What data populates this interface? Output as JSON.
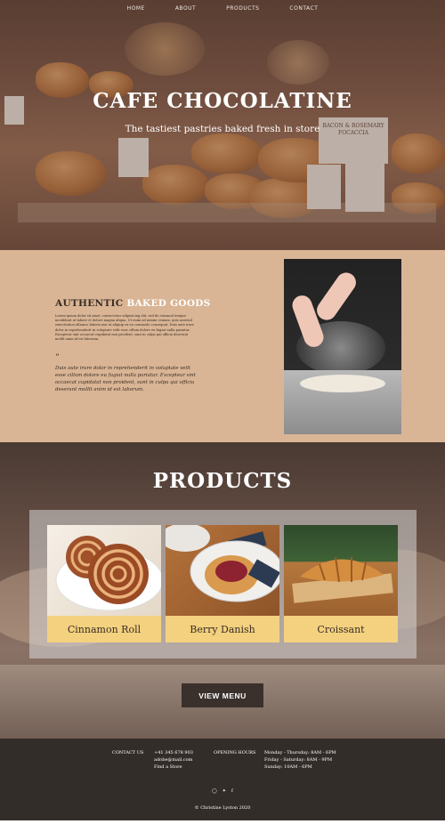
{
  "nav": {
    "items": [
      {
        "label": "HOME"
      },
      {
        "label": "ABOUT"
      },
      {
        "label": "PRODUCTS"
      },
      {
        "label": "CONTACT"
      }
    ]
  },
  "hero": {
    "title": "CAFE CHOCOLATINE",
    "subtitle": "The tastiest pastries baked fresh in store",
    "sign_text": "BACON & ROSEMARY FOCACCIA"
  },
  "about": {
    "heading_plain": "AUTHENTIC",
    "heading_highlight": "BAKED GOODS",
    "body": "Lorem ipsum dolor sit amet, consectetur adipisicing elit, sed do eiusmod tempor incididunt ut labore et dolore magna aliqua. Ut enim ad minim veniam, quis nostrud exercitation ullamco laboris nisi ut aliquip ex ea commodo consequat. Duis aute irure dolor in reprehenderit in voluptate velit esse cillum dolore eu fugiat nulla pariatur. Excepteur sint occaecat cupidatat non proident, sunt in culpa qui officia deserunt mollit anim id est laborum.",
    "quote_mark": "“",
    "quote": "Duis aute irure dolor in reprehenderit in voluptate velit esse cillum dolore eu fugiat nulla pariatur. Excepteur sint occaecat cupidatat non proident, sunt in culpa qui officia deserunt mollit anim id est laborum."
  },
  "products": {
    "title": "PRODUCTS",
    "items": [
      {
        "name": "Cinnamon Roll"
      },
      {
        "name": "Berry Danish"
      },
      {
        "name": "Croissant"
      }
    ],
    "view_menu_label": "VIEW MENU"
  },
  "footer": {
    "contact_heading": "CONTACT US",
    "phone": "+41 345 678 903",
    "email": "adobe@mail.com",
    "find_store": "Find a Store",
    "hours_heading": "OPENING HOURS",
    "hours": [
      "Monday - Thursday: 8AM - 6PM",
      "Friday - Saturday: 8AM - 9PM",
      "Sunday: 10AM - 6PM"
    ],
    "social_icons": [
      "instagram-icon",
      "twitter-icon",
      "facebook-icon"
    ],
    "copyright": "© Christine Lyston 2020"
  },
  "colors": {
    "about_bg": "#d9b595",
    "card_label_bg": "#f3d17f",
    "footer_bg": "#332d2a",
    "button_bg": "#3a302c"
  }
}
